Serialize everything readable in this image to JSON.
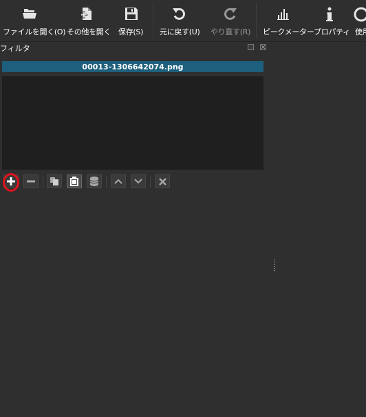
{
  "toolbar": {
    "open_file": "ファイルを開く(O)",
    "open_other": "その他を開く",
    "save": "保存(S)",
    "undo": "元に戻す(U)",
    "redo": "やり直す(R)",
    "peak_meter": "ピークメーター",
    "properties": "プロパティ",
    "recent": "使用"
  },
  "dock": {
    "title": "フィルタ"
  },
  "filters": {
    "clip_name": "00013-1306642074.png",
    "items": []
  },
  "icons": {
    "open_file": "folder-open-icon",
    "open_other": "file-add-icon",
    "save": "floppy-disk-icon",
    "undo": "undo-icon",
    "redo": "redo-icon",
    "peak_meter": "meter-bars-icon",
    "properties": "info-icon",
    "add_filter": "plus-icon",
    "remove_filter": "minus-icon",
    "copy_filters": "copy-icon",
    "paste_filters": "paste-icon",
    "save_preset": "database-icon",
    "move_up": "chevron-up-icon",
    "move_down": "chevron-down-icon",
    "deselect": "close-icon"
  },
  "colors": {
    "clip_title_bg": "#1d5f7c",
    "highlight_ring": "#e0121b",
    "background": "#2f2f2f"
  }
}
